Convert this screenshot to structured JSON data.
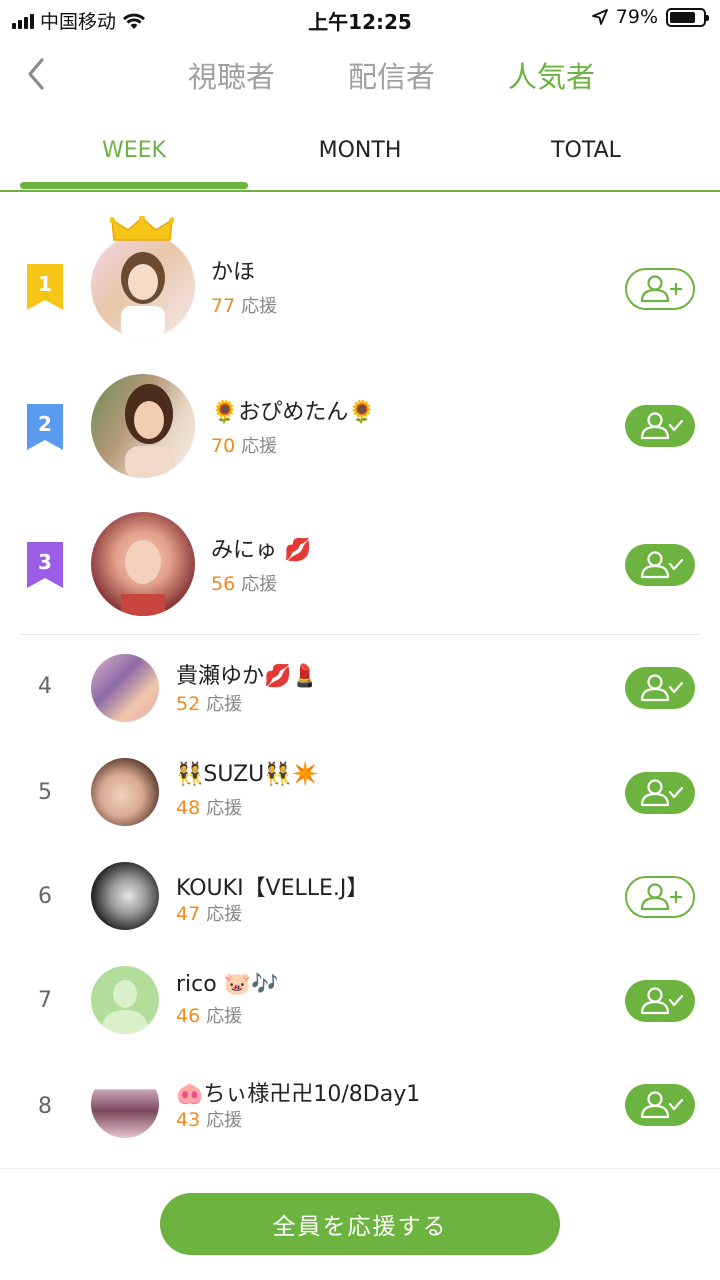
{
  "status_bar": {
    "carrier": "中国移动",
    "time": "上午12:25",
    "battery": "79%",
    "battery_level": 0.79
  },
  "nav": {
    "tabs": [
      {
        "label": "視聴者"
      },
      {
        "label": "配信者"
      },
      {
        "label": "人気者"
      }
    ],
    "active_tab": "人気者"
  },
  "period_tabs": {
    "items": [
      {
        "label": "WEEK"
      },
      {
        "label": "MONTH"
      },
      {
        "label": "TOTAL"
      }
    ],
    "active": "WEEK"
  },
  "cheer_label": "応援",
  "ranking": [
    {
      "rank": "1",
      "name": "かほ",
      "count": "77",
      "followed": false
    },
    {
      "rank": "2",
      "name": "🌻おぴめたん🌻",
      "count": "70",
      "followed": true
    },
    {
      "rank": "3",
      "name": "みにゅ 💋",
      "count": "56",
      "followed": true
    },
    {
      "rank": "4",
      "name": "貴瀬ゆか💋💄",
      "count": "52",
      "followed": true
    },
    {
      "rank": "5",
      "name": "👯SUZU👯✴️",
      "count": "48",
      "followed": true
    },
    {
      "rank": "6",
      "name": "KOUKI【VELLE.J】",
      "count": "47",
      "followed": false
    },
    {
      "rank": "7",
      "name": "rico 🐷🎶",
      "count": "46",
      "followed": true
    },
    {
      "rank": "8",
      "name": "🐽ちぃ様卍卍10/8Day1",
      "count": "43",
      "followed": true
    }
  ],
  "colors": {
    "accent": "#6db33f",
    "count": "#f28a1f",
    "badge_gold": "#f5c518",
    "badge_blue": "#5b9bef",
    "badge_purple": "#9b5de5"
  },
  "bottom": {
    "cheer_all_label": "全員を応援する"
  }
}
